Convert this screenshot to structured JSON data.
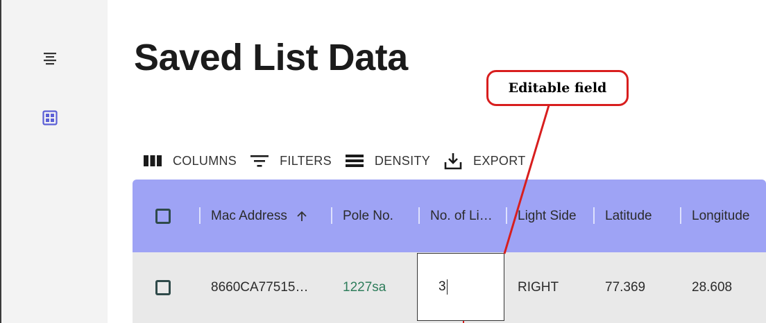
{
  "sidebar": {
    "icons": [
      {
        "name": "menu-icon",
        "color": "#333333"
      },
      {
        "name": "grid-view-icon",
        "color": "#5b5fd6"
      }
    ]
  },
  "page": {
    "title": "Saved List Data"
  },
  "annotation": {
    "label": "Editable field",
    "color": "#d81e1e"
  },
  "toolbar": {
    "columns_label": "COLUMNS",
    "filters_label": "FILTERS",
    "density_label": "DENSITY",
    "export_label": "EXPORT"
  },
  "table": {
    "header_color": "#9ea3f5",
    "columns": [
      "Mac Address",
      "Pole No.",
      "No. of Li…",
      "Light Side",
      "Latitude",
      "Longitude"
    ],
    "sort": {
      "column": "Mac Address",
      "direction": "ascending"
    },
    "rows": [
      {
        "mac_address": "8660CA77515…",
        "pole_no": "1227sa",
        "no_of_lights": "3",
        "light_side": "RIGHT",
        "latitude": "77.369",
        "longitude": "28.608"
      }
    ],
    "link_color": "#2e7d5b"
  }
}
